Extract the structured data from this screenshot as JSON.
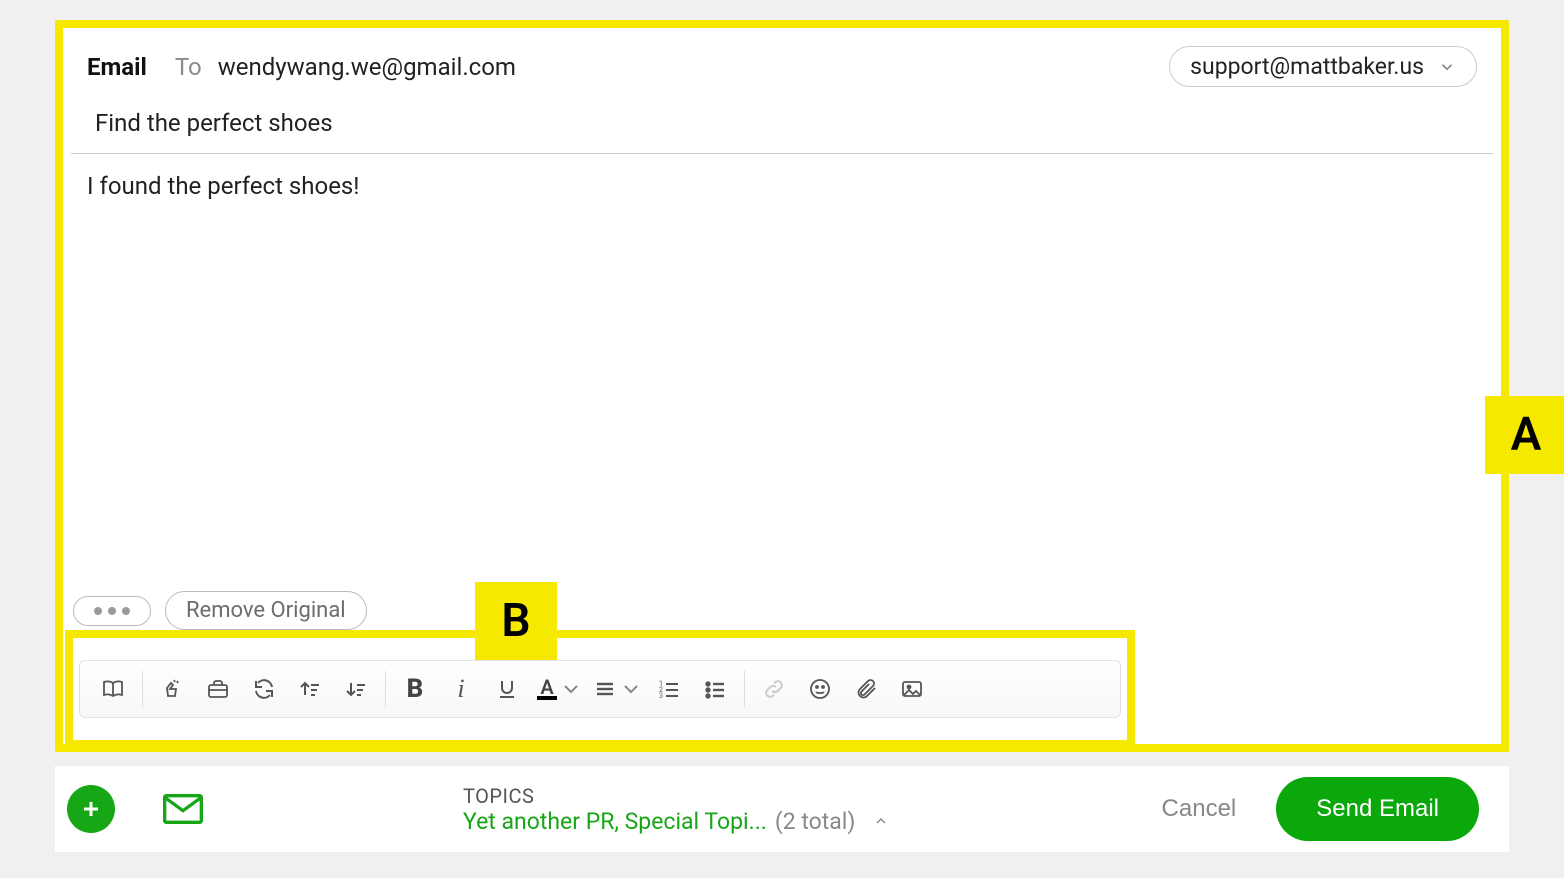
{
  "annotations": {
    "a": "A",
    "b": "B"
  },
  "compose": {
    "label": "Email",
    "to_label": "To",
    "recipient": "wendywang.we@gmail.com",
    "from_email": "support@mattbaker.us",
    "subject": "Find the perfect shoes",
    "body": "I found the perfect shoes!",
    "remove_original": "Remove Original"
  },
  "toolbar": {
    "icons": [
      "book-icon",
      "clap-icon",
      "briefcase-icon",
      "refresh-icon",
      "sort-asc-icon",
      "sort-desc-icon",
      "bold-icon",
      "italic-icon",
      "underline-icon",
      "text-color-icon",
      "align-icon",
      "ordered-list-icon",
      "unordered-list-icon",
      "link-icon",
      "emoji-icon",
      "attachment-icon",
      "image-icon"
    ]
  },
  "footer": {
    "topics_label": "TOPICS",
    "topics_text": "Yet another PR, Special Topi...",
    "topics_count": "(2 total)",
    "cancel": "Cancel",
    "send": "Send Email"
  }
}
